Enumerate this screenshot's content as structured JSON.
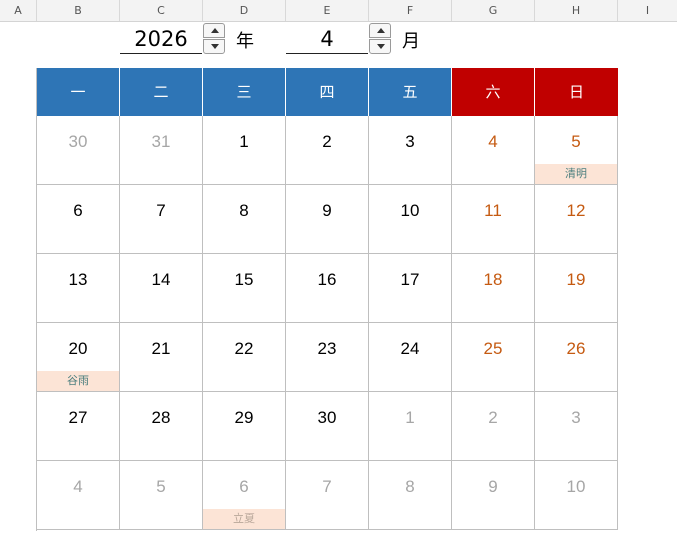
{
  "sheet": {
    "column_headers": [
      "A",
      "B",
      "C",
      "D",
      "E",
      "F",
      "G",
      "H",
      "I"
    ]
  },
  "controls": {
    "year_value": "2026",
    "year_unit": "年",
    "month_value": "4",
    "month_unit": "月"
  },
  "calendar": {
    "weekdays": [
      "一",
      "二",
      "三",
      "四",
      "五",
      "六",
      "日"
    ],
    "colors": {
      "weekday_header": "#2e75b6",
      "weekend_header": "#c00000",
      "weekend_day": "#c55a11",
      "other_month_day": "#a6a6a6",
      "holiday_label_bg": "#fce4d6"
    },
    "weeks": [
      [
        {
          "day": "30",
          "type": "other"
        },
        {
          "day": "31",
          "type": "other"
        },
        {
          "day": "1",
          "type": "current"
        },
        {
          "day": "2",
          "type": "current"
        },
        {
          "day": "3",
          "type": "current"
        },
        {
          "day": "4",
          "type": "weekend"
        },
        {
          "day": "5",
          "type": "weekend",
          "holiday": "清明"
        }
      ],
      [
        {
          "day": "6",
          "type": "current"
        },
        {
          "day": "7",
          "type": "current"
        },
        {
          "day": "8",
          "type": "current"
        },
        {
          "day": "9",
          "type": "current"
        },
        {
          "day": "10",
          "type": "current"
        },
        {
          "day": "11",
          "type": "weekend"
        },
        {
          "day": "12",
          "type": "weekend"
        }
      ],
      [
        {
          "day": "13",
          "type": "current"
        },
        {
          "day": "14",
          "type": "current"
        },
        {
          "day": "15",
          "type": "current"
        },
        {
          "day": "16",
          "type": "current"
        },
        {
          "day": "17",
          "type": "current"
        },
        {
          "day": "18",
          "type": "weekend"
        },
        {
          "day": "19",
          "type": "weekend"
        }
      ],
      [
        {
          "day": "20",
          "type": "current",
          "holiday": "谷雨"
        },
        {
          "day": "21",
          "type": "current"
        },
        {
          "day": "22",
          "type": "current"
        },
        {
          "day": "23",
          "type": "current"
        },
        {
          "day": "24",
          "type": "current"
        },
        {
          "day": "25",
          "type": "weekend"
        },
        {
          "day": "26",
          "type": "weekend"
        }
      ],
      [
        {
          "day": "27",
          "type": "current"
        },
        {
          "day": "28",
          "type": "current"
        },
        {
          "day": "29",
          "type": "current"
        },
        {
          "day": "30",
          "type": "current"
        },
        {
          "day": "1",
          "type": "other"
        },
        {
          "day": "2",
          "type": "other"
        },
        {
          "day": "3",
          "type": "other"
        }
      ],
      [
        {
          "day": "4",
          "type": "other"
        },
        {
          "day": "5",
          "type": "other"
        },
        {
          "day": "6",
          "type": "other",
          "holiday": "立夏"
        },
        {
          "day": "7",
          "type": "other"
        },
        {
          "day": "8",
          "type": "other"
        },
        {
          "day": "9",
          "type": "other"
        },
        {
          "day": "10",
          "type": "other"
        }
      ]
    ]
  }
}
